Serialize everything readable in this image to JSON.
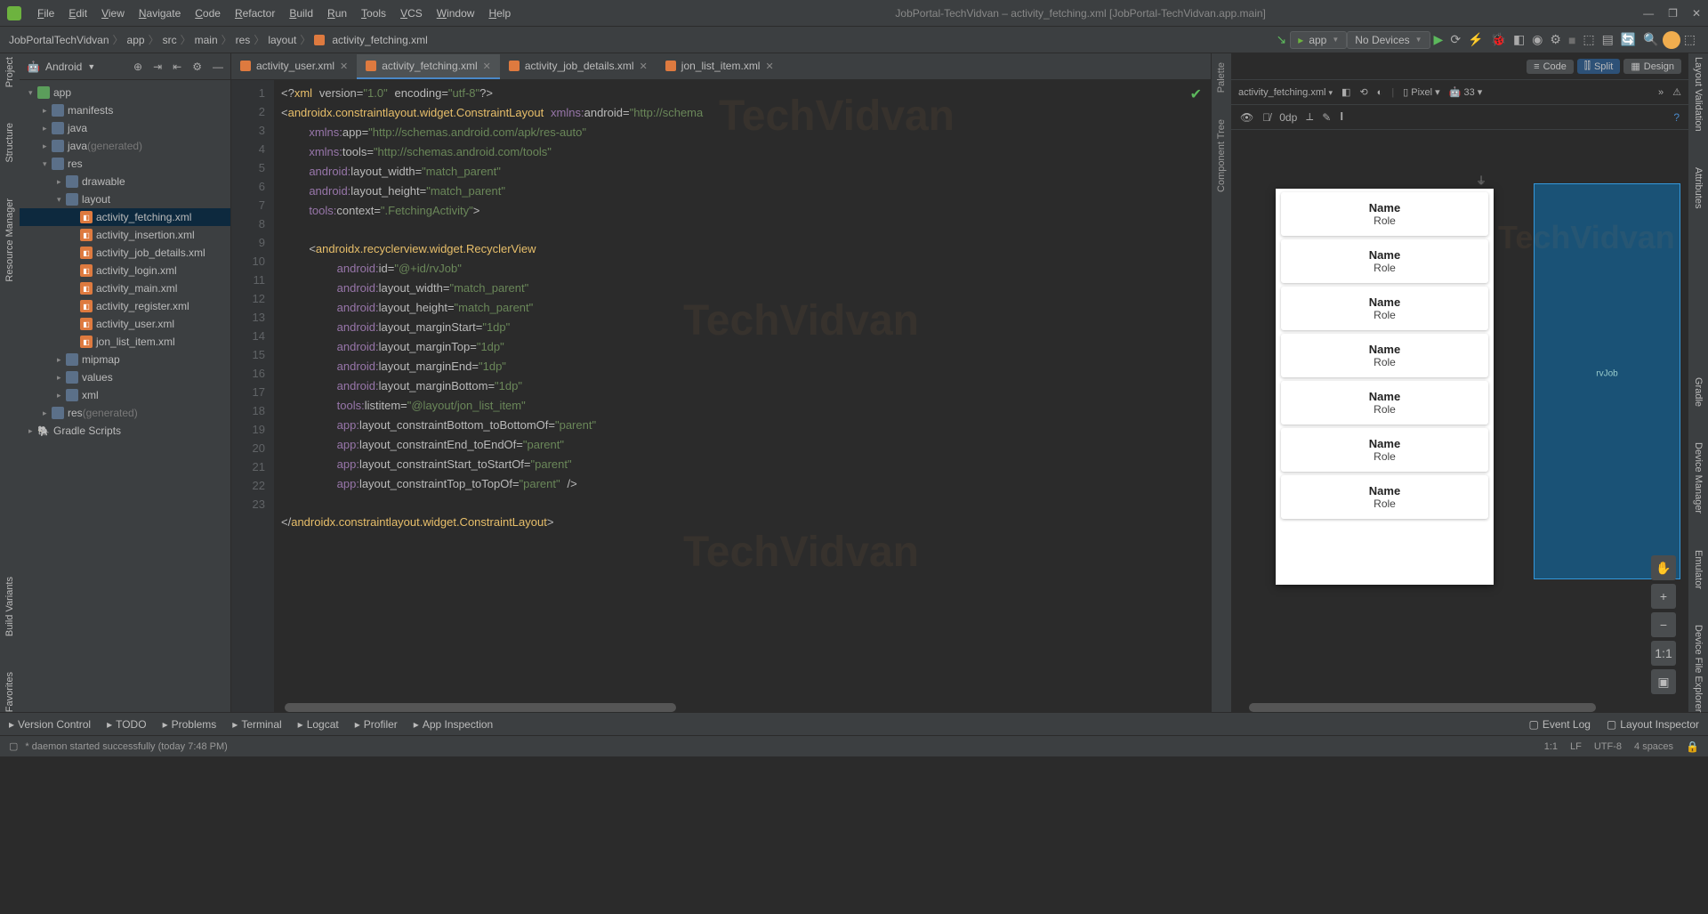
{
  "window": {
    "title": "JobPortal-TechVidvan – activity_fetching.xml [JobPortal-TechVidvan.app.main]"
  },
  "menus": [
    "File",
    "Edit",
    "View",
    "Navigate",
    "Code",
    "Refactor",
    "Build",
    "Run",
    "Tools",
    "VCS",
    "Window",
    "Help"
  ],
  "breadcrumbs": [
    "JobPortalTechVidvan",
    "app",
    "src",
    "main",
    "res",
    "layout",
    "activity_fetching.xml"
  ],
  "toolbar": {
    "run_config": "app",
    "devices": "No Devices"
  },
  "project_dropdown": "Android",
  "project_tree": [
    {
      "depth": 0,
      "arrow": "▾",
      "icon": "module",
      "label": "app"
    },
    {
      "depth": 1,
      "arrow": "▸",
      "icon": "folder",
      "label": "manifests"
    },
    {
      "depth": 1,
      "arrow": "▸",
      "icon": "folder",
      "label": "java"
    },
    {
      "depth": 1,
      "arrow": "▸",
      "icon": "folder",
      "label": "java",
      "muted": "(generated)"
    },
    {
      "depth": 1,
      "arrow": "▾",
      "icon": "folder",
      "label": "res"
    },
    {
      "depth": 2,
      "arrow": "▸",
      "icon": "folder",
      "label": "drawable"
    },
    {
      "depth": 2,
      "arrow": "▾",
      "icon": "folder",
      "label": "layout"
    },
    {
      "depth": 3,
      "arrow": "",
      "icon": "xml",
      "label": "activity_fetching.xml",
      "selected": true
    },
    {
      "depth": 3,
      "arrow": "",
      "icon": "xml",
      "label": "activity_insertion.xml"
    },
    {
      "depth": 3,
      "arrow": "",
      "icon": "xml",
      "label": "activity_job_details.xml"
    },
    {
      "depth": 3,
      "arrow": "",
      "icon": "xml",
      "label": "activity_login.xml"
    },
    {
      "depth": 3,
      "arrow": "",
      "icon": "xml",
      "label": "activity_main.xml"
    },
    {
      "depth": 3,
      "arrow": "",
      "icon": "xml",
      "label": "activity_register.xml"
    },
    {
      "depth": 3,
      "arrow": "",
      "icon": "xml",
      "label": "activity_user.xml"
    },
    {
      "depth": 3,
      "arrow": "",
      "icon": "xml",
      "label": "jon_list_item.xml"
    },
    {
      "depth": 2,
      "arrow": "▸",
      "icon": "folder",
      "label": "mipmap"
    },
    {
      "depth": 2,
      "arrow": "▸",
      "icon": "folder",
      "label": "values"
    },
    {
      "depth": 2,
      "arrow": "▸",
      "icon": "folder",
      "label": "xml"
    },
    {
      "depth": 1,
      "arrow": "▸",
      "icon": "folder",
      "label": "res",
      "muted": "(generated)"
    },
    {
      "depth": 0,
      "arrow": "▸",
      "icon": "gradle",
      "label": "Gradle Scripts"
    }
  ],
  "editor_tabs": [
    {
      "label": "activity_user.xml",
      "active": false
    },
    {
      "label": "activity_fetching.xml",
      "active": true
    },
    {
      "label": "activity_job_details.xml",
      "active": false
    },
    {
      "label": "jon_list_item.xml",
      "active": false
    }
  ],
  "view_modes": {
    "code": "Code",
    "split": "Split",
    "design": "Design"
  },
  "design_bar": {
    "filename": "activity_fetching.xml",
    "device": "Pixel",
    "api": "33",
    "zero": "0dp"
  },
  "preview_items": [
    {
      "name": "Name",
      "role": "Role"
    },
    {
      "name": "Name",
      "role": "Role"
    },
    {
      "name": "Name",
      "role": "Role"
    },
    {
      "name": "Name",
      "role": "Role"
    },
    {
      "name": "Name",
      "role": "Role"
    },
    {
      "name": "Name",
      "role": "Role"
    },
    {
      "name": "Name",
      "role": "Role"
    }
  ],
  "blueprint_label": "rvJob",
  "zoom_labels": {
    "fit": "1:1",
    "plus": "+",
    "minus": "−",
    "pan": "✋",
    "square": "▣"
  },
  "bottom_tools": [
    "Version Control",
    "TODO",
    "Problems",
    "Terminal",
    "Logcat",
    "Profiler",
    "App Inspection"
  ],
  "bottom_right": [
    "Event Log",
    "Layout Inspector"
  ],
  "side_left": [
    "Project",
    "Structure",
    "Resource Manager"
  ],
  "side_left_b": [
    "Build Variants",
    "Favorites"
  ],
  "side_right": [
    "Layout Validation",
    "Attributes"
  ],
  "side_right_b": [
    "Gradle",
    "Device Manager",
    "Emulator",
    "Device File Explorer"
  ],
  "palette_labels": [
    "Palette",
    "Component Tree"
  ],
  "status": {
    "message": "* daemon started successfully (today 7:48 PM)",
    "pos": "1:1",
    "lf": "LF",
    "enc": "UTF-8",
    "indent": "4 spaces"
  },
  "code_lines": [
    "1",
    "2",
    "3",
    "4",
    "5",
    "6",
    "7",
    "8",
    "9",
    "10",
    "11",
    "12",
    "13",
    "14",
    "15",
    "16",
    "17",
    "18",
    "19",
    "20",
    "21",
    "22",
    "23"
  ]
}
